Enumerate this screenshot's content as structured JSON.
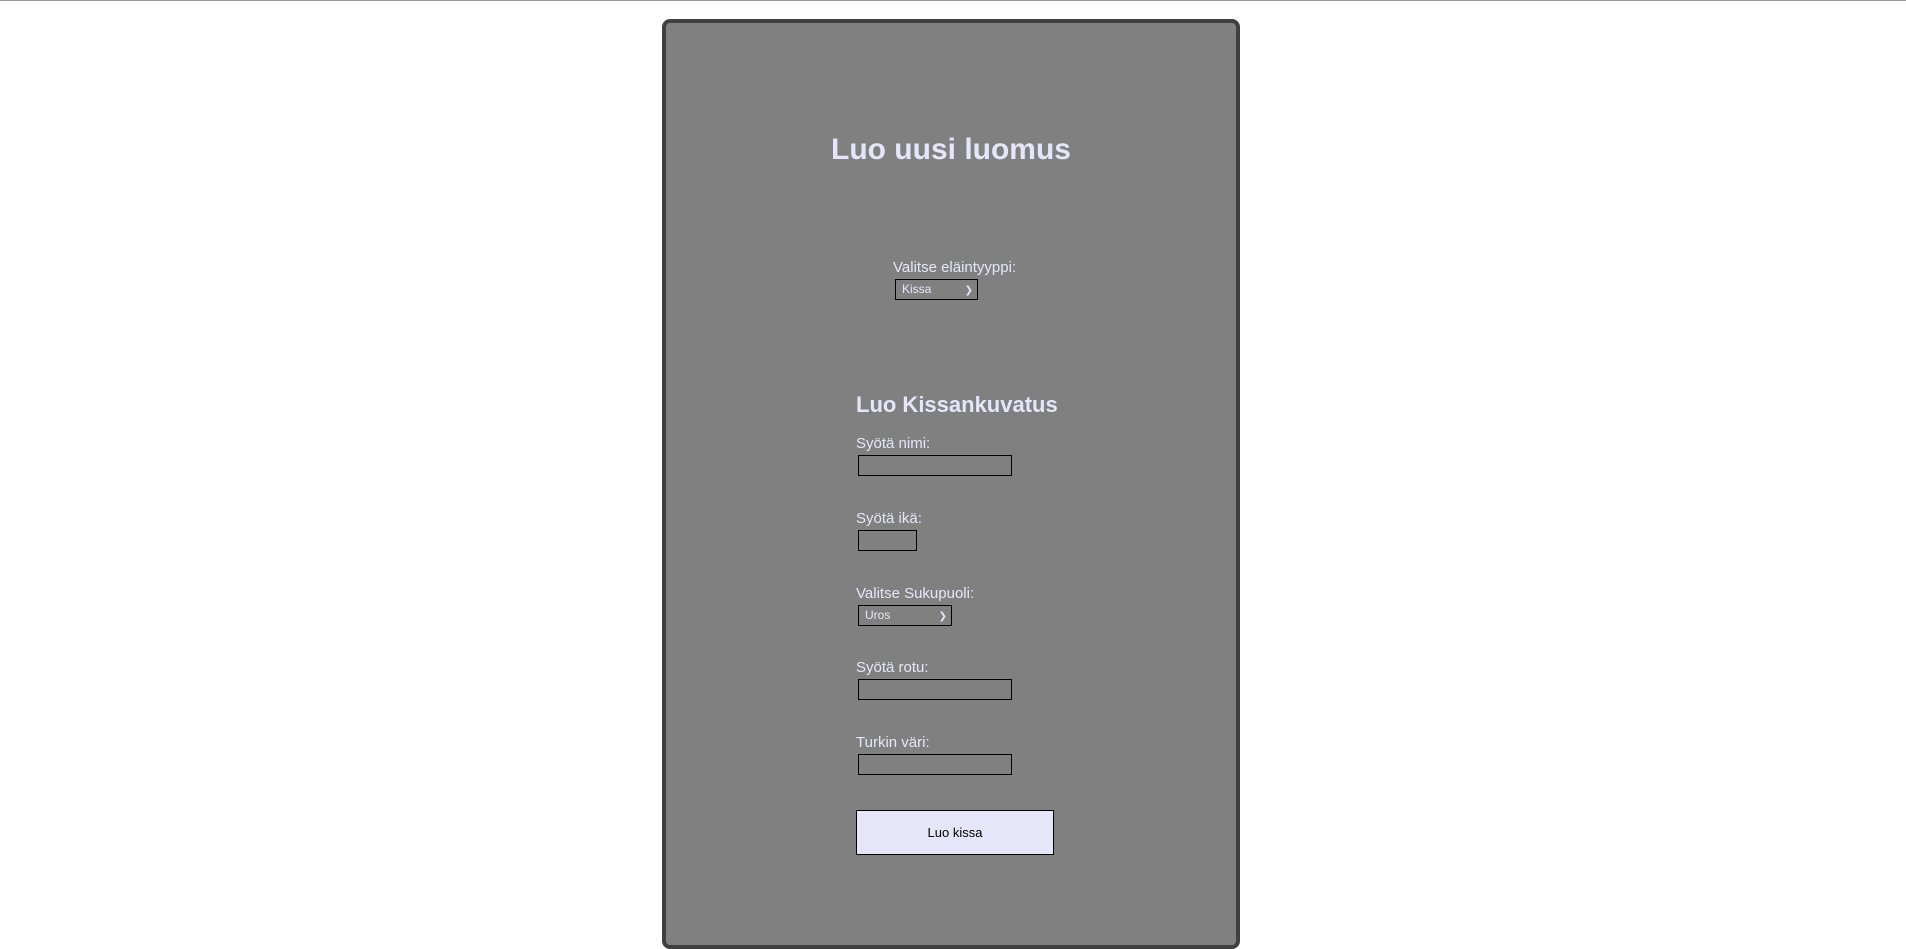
{
  "page": {
    "title": "Luo uusi luomus"
  },
  "animal_type": {
    "label": "Valitse eläintyyppi:",
    "selected": "Kissa"
  },
  "form": {
    "heading": "Luo Kissankuvatus",
    "name": {
      "label": "Syötä nimi:",
      "value": ""
    },
    "age": {
      "label": "Syötä ikä:",
      "value": ""
    },
    "gender": {
      "label": "Valitse Sukupuoli:",
      "selected": "Uros"
    },
    "breed": {
      "label": "Syötä rotu:",
      "value": ""
    },
    "fur_color": {
      "label": "Turkin väri:",
      "value": ""
    },
    "submit_label": "Luo kissa"
  },
  "colors": {
    "panel_background": "#808080",
    "panel_border": "#3f3f3f",
    "text_accent": "#e6e6fa",
    "button_background": "#e6e6fa"
  }
}
